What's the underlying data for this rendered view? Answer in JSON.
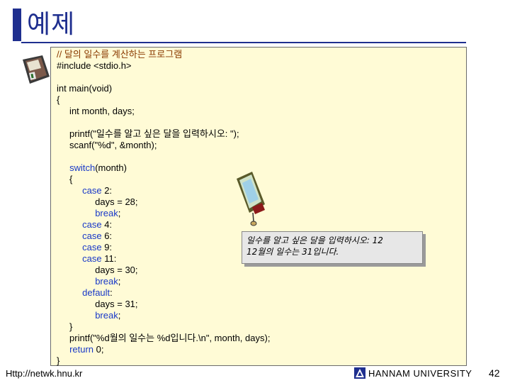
{
  "slide": {
    "title": "예제"
  },
  "code": {
    "lines": [
      {
        "parts": [
          {
            "t": "// 달의 일수를 계산하는 프로그램",
            "c": "cmt"
          }
        ]
      },
      {
        "parts": [
          {
            "t": "#include <stdio.h>"
          }
        ]
      },
      {
        "parts": [
          {
            "t": ""
          }
        ]
      },
      {
        "parts": [
          {
            "t": "int main(void)"
          }
        ]
      },
      {
        "parts": [
          {
            "t": "{"
          }
        ]
      },
      {
        "parts": [
          {
            "t": "     int month, days;"
          }
        ]
      },
      {
        "parts": [
          {
            "t": ""
          }
        ]
      },
      {
        "parts": [
          {
            "t": "     printf(\"일수를 알고 싶은 달을 입력하시오: \");"
          }
        ]
      },
      {
        "parts": [
          {
            "t": "     scanf(\"%d\", &month);"
          }
        ]
      },
      {
        "parts": [
          {
            "t": ""
          }
        ]
      },
      {
        "parts": [
          {
            "t": "     "
          },
          {
            "t": "switch",
            "c": "kw"
          },
          {
            "t": "(month)"
          }
        ]
      },
      {
        "parts": [
          {
            "t": "     {"
          }
        ]
      },
      {
        "parts": [
          {
            "t": "          "
          },
          {
            "t": "case",
            "c": "kw"
          },
          {
            "t": " 2:"
          }
        ]
      },
      {
        "parts": [
          {
            "t": "               days = 28;"
          }
        ]
      },
      {
        "parts": [
          {
            "t": "               "
          },
          {
            "t": "break",
            "c": "kw"
          },
          {
            "t": ";"
          }
        ]
      },
      {
        "parts": [
          {
            "t": "          "
          },
          {
            "t": "case",
            "c": "kw"
          },
          {
            "t": " 4:"
          }
        ]
      },
      {
        "parts": [
          {
            "t": "          "
          },
          {
            "t": "case",
            "c": "kw"
          },
          {
            "t": " 6:"
          }
        ]
      },
      {
        "parts": [
          {
            "t": "          "
          },
          {
            "t": "case",
            "c": "kw"
          },
          {
            "t": " 9:"
          }
        ]
      },
      {
        "parts": [
          {
            "t": "          "
          },
          {
            "t": "case",
            "c": "kw"
          },
          {
            "t": " 11:"
          }
        ]
      },
      {
        "parts": [
          {
            "t": "               days = 30;"
          }
        ]
      },
      {
        "parts": [
          {
            "t": "               "
          },
          {
            "t": "break",
            "c": "kw"
          },
          {
            "t": ";"
          }
        ]
      },
      {
        "parts": [
          {
            "t": "          "
          },
          {
            "t": "default",
            "c": "kw"
          },
          {
            "t": ":"
          }
        ]
      },
      {
        "parts": [
          {
            "t": "               days = 31;"
          }
        ]
      },
      {
        "parts": [
          {
            "t": "               "
          },
          {
            "t": "break",
            "c": "kw"
          },
          {
            "t": ";"
          }
        ]
      },
      {
        "parts": [
          {
            "t": "     }"
          }
        ]
      },
      {
        "parts": [
          {
            "t": "     printf(\"%d월의 일수는 %d입니다.\\n\", month, days);"
          }
        ]
      },
      {
        "parts": [
          {
            "t": "     "
          },
          {
            "t": "return",
            "c": "kw"
          },
          {
            "t": " 0;"
          }
        ]
      },
      {
        "parts": [
          {
            "t": "}"
          }
        ]
      }
    ]
  },
  "output": {
    "line1": "일수를 알고 싶은 달을 입력하시오: 12",
    "line2": "12월의 일수는 31입니다."
  },
  "footer": {
    "url": "Http://netwk.hnu.kr",
    "university": "HANNAM UNIVERSITY",
    "page_number": "42"
  },
  "colors": {
    "title": "#1f2f8f",
    "code_background": "#fffbd6",
    "keyword": "#1838c8",
    "comment": "#8a3a00"
  },
  "icons": [
    "floppy-disk-icon",
    "monitor-icon",
    "university-logo-icon"
  ]
}
